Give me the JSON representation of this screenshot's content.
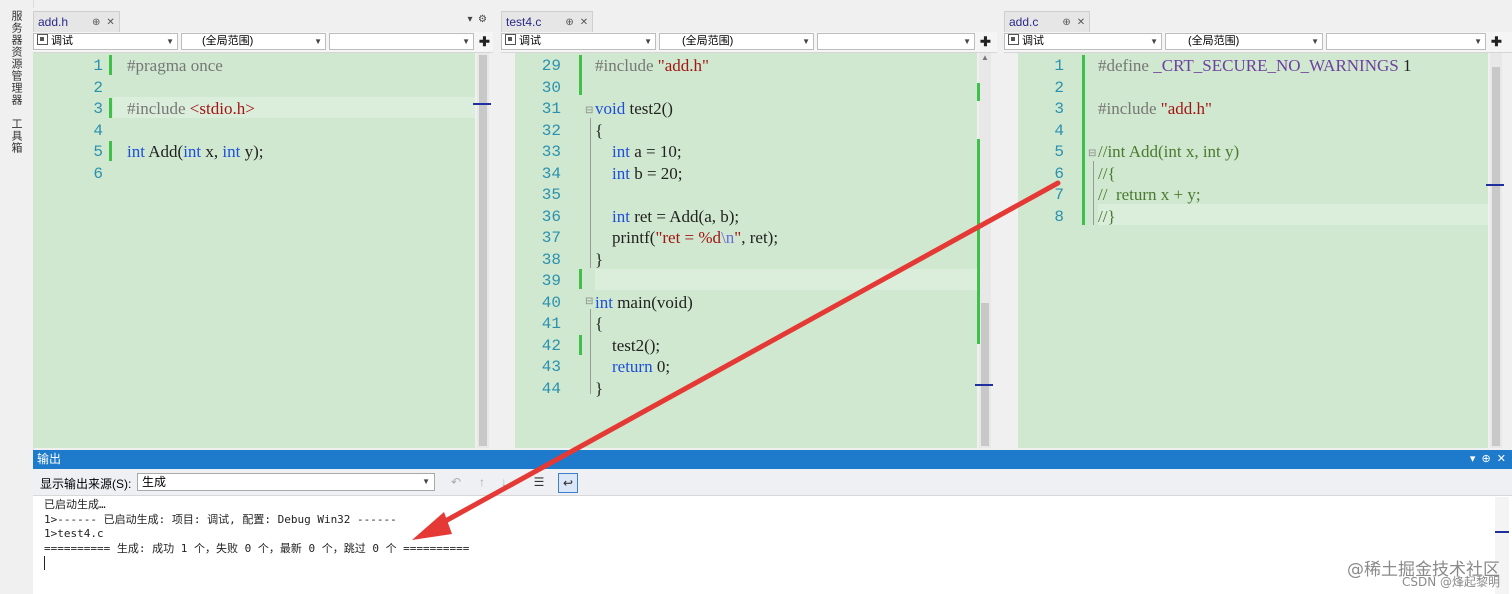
{
  "side_panel": {
    "items": [
      "服务器资源管理器",
      "工具箱"
    ]
  },
  "panes": [
    {
      "tab": "add.h",
      "nav": {
        "config": "调试",
        "scope": "(全局范围)",
        "member": ""
      },
      "line_numbers": [
        "1",
        "2",
        "3",
        "4",
        "5",
        "6"
      ],
      "lines": [
        {
          "t": "#pragma once"
        },
        {
          "t": ""
        },
        {
          "a": "#include ",
          "b": "<stdio.h>"
        },
        {
          "t": ""
        },
        {
          "k1": "int",
          "m1": " Add(",
          "k2": "int",
          "m2": " x, ",
          "k3": "int",
          "m3": " y);"
        },
        {
          "t": ""
        }
      ]
    },
    {
      "tab": "test4.c",
      "nav": {
        "config": "调试",
        "scope": "(全局范围)",
        "member": ""
      },
      "line_numbers": [
        "29",
        "30",
        "31",
        "32",
        "33",
        "34",
        "35",
        "36",
        "37",
        "38",
        "39",
        "40",
        "41",
        "42",
        "43",
        "44"
      ],
      "lines": [
        {
          "a": "#include ",
          "b": "\"add.h\""
        },
        {
          "t": ""
        },
        {
          "k": "void",
          "r": " test2()"
        },
        {
          "t": "{"
        },
        {
          "i": "    ",
          "k": "int",
          "r": " a = 10;"
        },
        {
          "i": "    ",
          "k": "int",
          "r": " b = 20;"
        },
        {
          "t": ""
        },
        {
          "i": "    ",
          "k": "int",
          "r": " ret = Add(a, b);"
        },
        {
          "p1": "    printf(",
          "s1": "\"ret = %d",
          "e": "\\n",
          "s2": "\"",
          "p2": ", ret);"
        },
        {
          "t": "}"
        },
        {
          "t": ""
        },
        {
          "k": "int",
          "r": " main(void)"
        },
        {
          "t": "{"
        },
        {
          "t": "    test2();"
        },
        {
          "i": "    ",
          "k": "return",
          "r": " 0;"
        },
        {
          "t": "}"
        }
      ]
    },
    {
      "tab": "add.c",
      "nav": {
        "config": "调试",
        "scope": "(全局范围)",
        "member": ""
      },
      "line_numbers": [
        "1",
        "2",
        "3",
        "4",
        "5",
        "6",
        "7",
        "8"
      ],
      "lines": [
        {
          "a": "#define ",
          "m": "_CRT_SECURE_NO_WARNINGS",
          "c": " 1"
        },
        {
          "t": ""
        },
        {
          "a": "#include ",
          "b": "\"add.h\""
        },
        {
          "t": ""
        },
        {
          "t": "//int Add(int x, int y)"
        },
        {
          "t": "//{"
        },
        {
          "t": "//  return x + y;"
        },
        {
          "t": "//}"
        }
      ]
    }
  ],
  "output": {
    "title": "输出",
    "source_label": "显示输出来源(S):",
    "source_value": "生成",
    "lines": [
      "已启动生成…",
      "1>------ 已启动生成: 项目: 调试, 配置: Debug Win32 ------",
      "1>test4.c",
      "========== 生成: 成功 1 个，失败 0 个，最新 0 个，跳过 0 个 =========="
    ]
  },
  "watermark": {
    "line1": "@稀土掘金技术社区",
    "line2": "CSDN @烽起黎明"
  },
  "colors": {
    "editor_bg": "#cfe8cf",
    "title_blue": "#1e7acb",
    "change_bar": "#3fc04a",
    "arrow": "#e53935"
  }
}
